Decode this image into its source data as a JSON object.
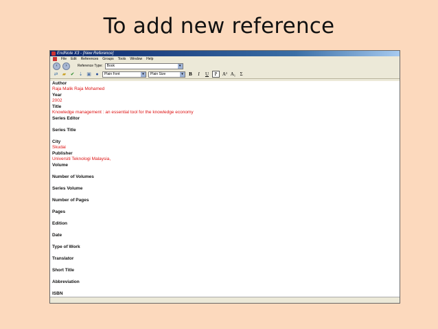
{
  "slide": {
    "title": "To add new reference"
  },
  "window": {
    "title": "EndNote X3 - [New Reference]"
  },
  "menu": [
    "File",
    "Edit",
    "References",
    "Groups",
    "Tools",
    "Window",
    "Help"
  ],
  "reftype": {
    "label": "Reference Type:",
    "value": "Book"
  },
  "toolbar": {
    "font": "Plain Font",
    "size": "Plain Size",
    "bold": "B",
    "italic": "I",
    "underline": "U",
    "plain": "P",
    "superscript": "A¹",
    "subscript": "A₁",
    "symbol": "Σ"
  },
  "fields": [
    {
      "label": "Author",
      "value": "Raja Malik Raja Mohamed"
    },
    {
      "label": "Year",
      "value": " 2002"
    },
    {
      "label": "Title",
      "value": "Knowledge management : an essential tool for the knowledge economy"
    },
    {
      "label": "Series Editor",
      "value": ""
    },
    {
      "label": "Series Title",
      "value": ""
    },
    {
      "label": "City",
      "value": "Skudai"
    },
    {
      "label": "Publisher",
      "value": "Universiti Teknologi Malaysia,"
    },
    {
      "label": "Volume",
      "value": ""
    },
    {
      "label": "Number of Volumes",
      "value": ""
    },
    {
      "label": "Series Volume",
      "value": ""
    },
    {
      "label": "Number of Pages",
      "value": ""
    },
    {
      "label": "Pages",
      "value": ""
    },
    {
      "label": "Edition",
      "value": ""
    },
    {
      "label": "Date",
      "value": ""
    },
    {
      "label": "Type of Work",
      "value": ""
    },
    {
      "label": "Translator",
      "value": ""
    },
    {
      "label": "Short Title",
      "value": ""
    },
    {
      "label": "Abbreviation",
      "value": ""
    },
    {
      "label": "ISBN",
      "value": ""
    }
  ]
}
